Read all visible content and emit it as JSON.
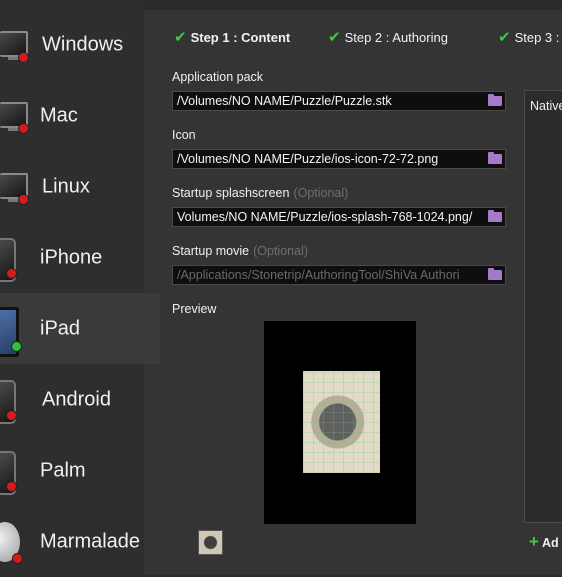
{
  "sidebar": {
    "items": [
      {
        "label": "Windows",
        "status": "red"
      },
      {
        "label": "Mac",
        "status": "red"
      },
      {
        "label": "Linux",
        "status": "red"
      },
      {
        "label": "iPhone",
        "status": "red"
      },
      {
        "label": "iPad",
        "status": "green",
        "selected": true
      },
      {
        "label": "Android",
        "status": "red"
      },
      {
        "label": "Palm",
        "status": "red"
      },
      {
        "label": "Marmalade",
        "status": "red"
      }
    ]
  },
  "steps": [
    {
      "label": "Step 1 : Content",
      "current": true
    },
    {
      "label": "Step 2 : Authoring"
    },
    {
      "label": "Step 3 : "
    }
  ],
  "form": {
    "application_pack": {
      "label": "Application pack",
      "value": "/Volumes/NO NAME/Puzzle/Puzzle.stk"
    },
    "icon": {
      "label": "Icon",
      "value": "/Volumes/NO NAME/Puzzle/ios-icon-72-72.png"
    },
    "splashscreen": {
      "label": "Startup splashscreen",
      "optional": "(Optional)",
      "value": "/Volumes/NO NAME/Puzzle/ios-splash-768-1024.png"
    },
    "movie": {
      "label": "Startup movie",
      "optional": "(Optional)",
      "placeholder": "/Applications/Stonetrip/AuthoringTool/ShiVa Authori"
    },
    "preview_label": "Preview"
  },
  "native": {
    "title": "Native",
    "add_label": "Ad"
  },
  "colors": {
    "status_red": "#d51b1b",
    "status_green": "#2fc13b",
    "check": "#3ccb3c",
    "folder": "#a57ac9"
  }
}
